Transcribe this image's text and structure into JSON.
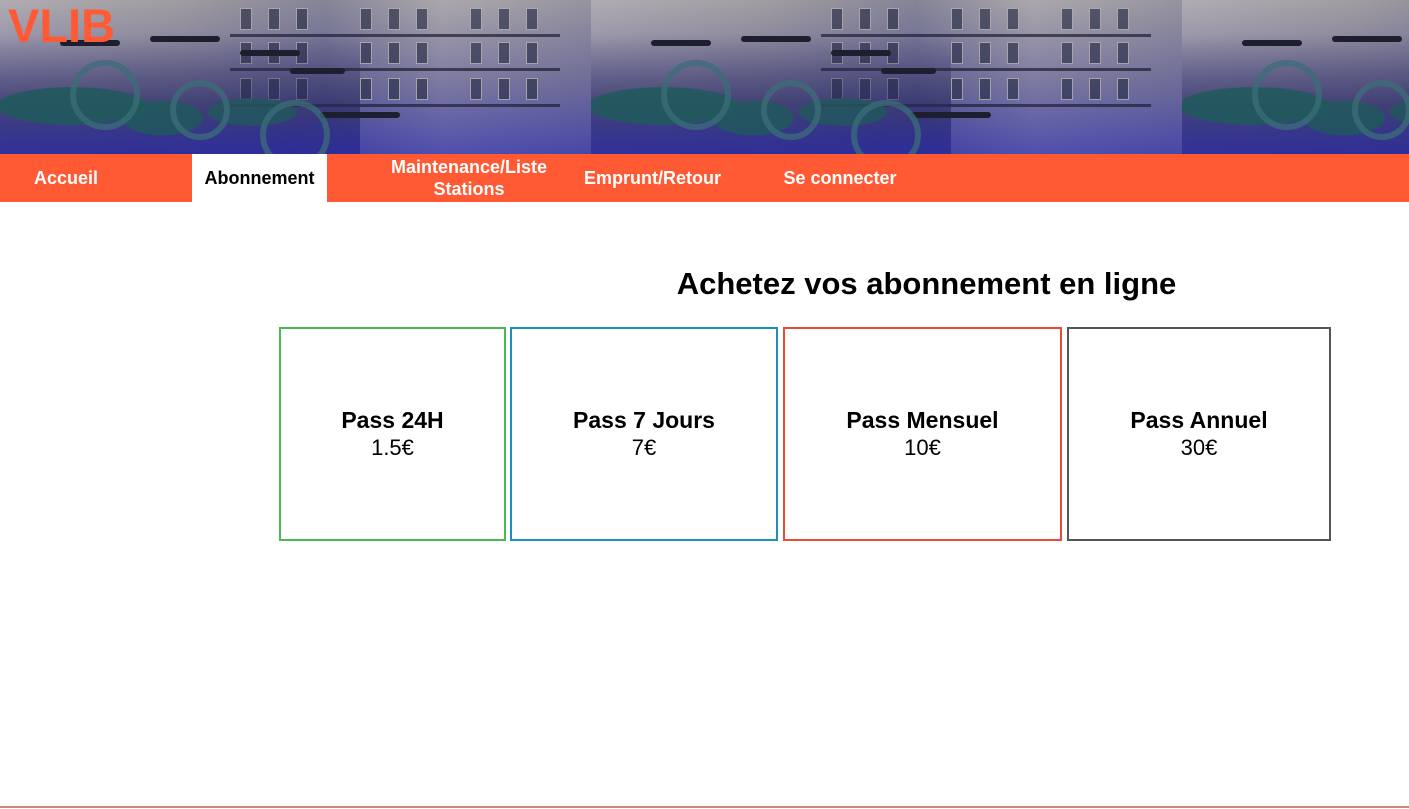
{
  "brand": {
    "logo_text": "VLIB",
    "accent_color": "#ff5a34"
  },
  "nav": {
    "items": [
      {
        "label": "Accueil",
        "active": false
      },
      {
        "label": "Abonnement",
        "active": true
      },
      {
        "label": "Maintenance/Liste Stations",
        "active": false
      },
      {
        "label": "Emprunt/Retour",
        "active": false
      },
      {
        "label": "Se connecter",
        "active": false
      }
    ]
  },
  "main": {
    "title": "Achetez vos abonnement en ligne",
    "passes": [
      {
        "name": "Pass 24H",
        "price": "1.5€",
        "border_color": "#4cb851"
      },
      {
        "name": "Pass 7 Jours",
        "price": "7€",
        "border_color": "#1e8fc0"
      },
      {
        "name": "Pass Mensuel",
        "price": "10€",
        "border_color": "#ea4a3a"
      },
      {
        "name": "Pass Annuel",
        "price": "30€",
        "border_color": "#555555"
      }
    ]
  }
}
